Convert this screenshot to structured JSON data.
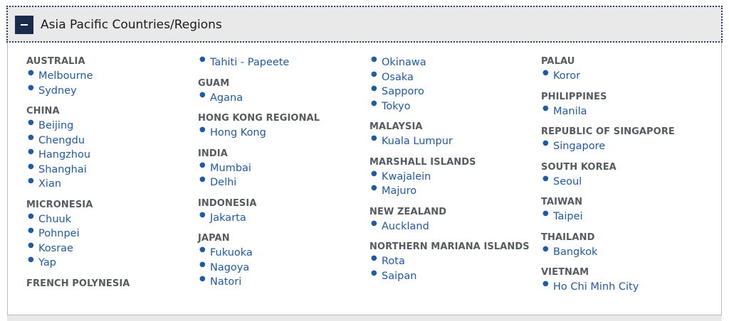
{
  "accordion": {
    "title": "Asia Pacific Countries/Regions",
    "toggle_symbol": "minus-icon"
  },
  "colors": {
    "header_bg": "#e9e9e9",
    "toggle_bg": "#1b2b4b",
    "link": "#1f5aa6",
    "country_heading": "#555a60"
  },
  "columns": [
    {
      "groups": [
        {
          "country": "AUSTRALIA",
          "cities": [
            "Melbourne",
            "Sydney"
          ]
        },
        {
          "country": "CHINA",
          "cities": [
            "Beijing",
            "Chengdu",
            "Hangzhou",
            "Shanghai",
            "Xian"
          ]
        },
        {
          "country": "MICRONESIA",
          "cities": [
            "Chuuk",
            "Pohnpei",
            "Kosrae",
            "Yap"
          ]
        },
        {
          "country": "FRENCH POLYNESIA",
          "cities": []
        }
      ]
    },
    {
      "groups": [
        {
          "country": "",
          "cities": [
            "Tahiti - Papeete"
          ]
        },
        {
          "country": "GUAM",
          "cities": [
            "Agana"
          ]
        },
        {
          "country": "HONG KONG REGIONAL",
          "cities": [
            "Hong Kong"
          ]
        },
        {
          "country": "INDIA",
          "cities": [
            "Mumbai",
            "Delhi"
          ]
        },
        {
          "country": "INDONESIA",
          "cities": [
            "Jakarta"
          ]
        },
        {
          "country": "JAPAN",
          "cities": [
            "Fukuoka",
            "Nagoya",
            "Natori"
          ]
        }
      ]
    },
    {
      "groups": [
        {
          "country": "",
          "cities": [
            "Okinawa",
            "Osaka",
            "Sapporo",
            "Tokyo"
          ]
        },
        {
          "country": "MALAYSIA",
          "cities": [
            "Kuala Lumpur"
          ]
        },
        {
          "country": "MARSHALL ISLANDS",
          "cities": [
            "Kwajalein",
            "Majuro"
          ]
        },
        {
          "country": "NEW ZEALAND",
          "cities": [
            "Auckland"
          ]
        },
        {
          "country": "NORTHERN MARIANA ISLANDS",
          "cities": [
            "Rota",
            "Saipan"
          ]
        }
      ]
    },
    {
      "groups": [
        {
          "country": "PALAU",
          "cities": [
            "Koror"
          ]
        },
        {
          "country": "PHILIPPINES",
          "cities": [
            "Manila"
          ]
        },
        {
          "country": "REPUBLIC OF SINGAPORE",
          "cities": [
            "Singapore"
          ]
        },
        {
          "country": "SOUTH KOREA",
          "cities": [
            "Seoul"
          ]
        },
        {
          "country": "TAIWAN",
          "cities": [
            "Taipei"
          ]
        },
        {
          "country": "THAILAND",
          "cities": [
            "Bangkok"
          ]
        },
        {
          "country": "VIETNAM",
          "cities": [
            "Ho Chi Minh City"
          ]
        }
      ]
    }
  ]
}
